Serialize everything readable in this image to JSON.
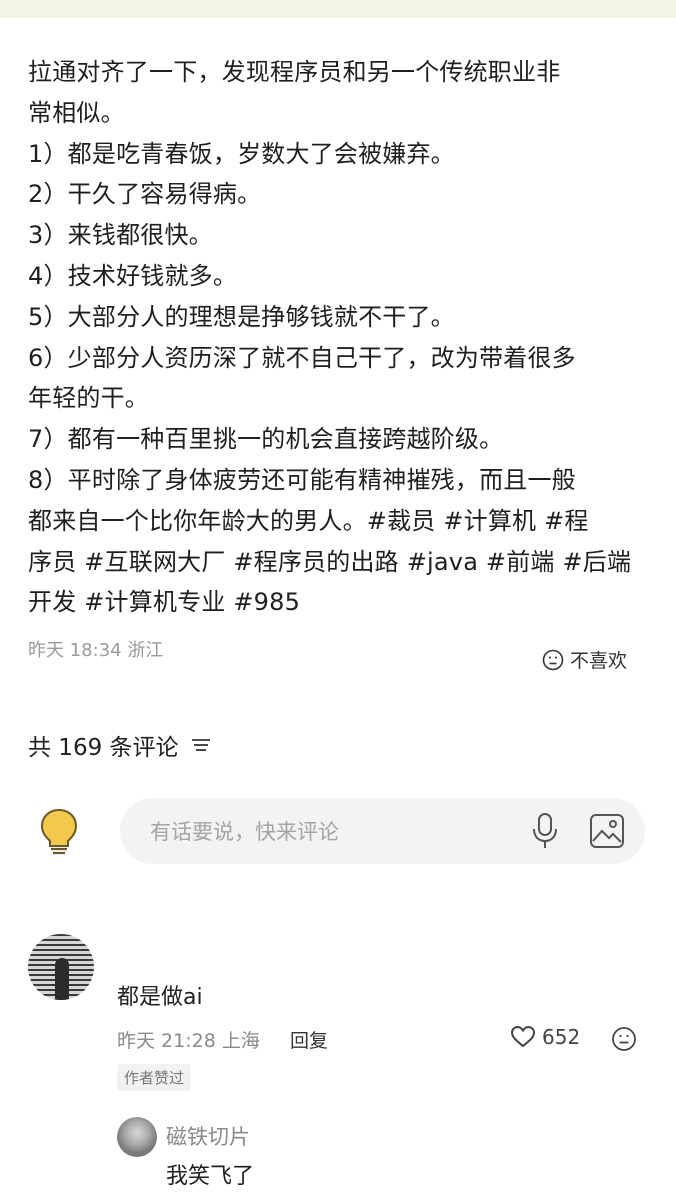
{
  "post": {
    "lines": [
      "拉通对齐了一下，发现程序员和另一个传统职业非",
      "常相似。",
      "1）都是吃青春饭，岁数大了会被嫌弃。",
      "2）干久了容易得病。",
      "3）来钱都很快。",
      "4）技术好钱就多。",
      "5）大部分人的理想是挣够钱就不干了。",
      "6）少部分人资历深了就不自己干了，改为带着很多",
      "年轻的干。",
      "7）都有一种百里挑一的机会直接跨越阶级。",
      "8）平时除了身体疲劳还可能有精神摧残，而且一般",
      "都来自一个比你年龄大的男人。#裁员 #计算机 #程",
      "序员 #互联网大厂 #程序员的出路 #java #前端 #后端",
      "开发 #计算机专业 #985"
    ],
    "meta": "昨天 18:34 浙江",
    "dislike_label": "不喜欢"
  },
  "comments_header": {
    "title": "共 169 条评论"
  },
  "comment_input": {
    "placeholder": "有话要说，快来评论"
  },
  "comment": {
    "text": "都是做ai",
    "time_location": "昨天 21:28 上海",
    "reply_label": "回复",
    "likes": "652",
    "author_liked": "作者赞过"
  },
  "reply": {
    "name": "磁铁切片",
    "text": "我笑飞了"
  },
  "watermark": "",
  "colors": {
    "meta_gray": "#9a9a9a",
    "input_bg": "#f3f3f3",
    "bulb_yellow": "#f2c94c"
  },
  "icons": {
    "dislike": "sad-face-icon",
    "filter": "filter-lines-icon",
    "bulb": "lightbulb-icon",
    "mic": "microphone-icon",
    "image": "image-icon",
    "like": "heart-icon",
    "emoji": "emoji-icon"
  }
}
